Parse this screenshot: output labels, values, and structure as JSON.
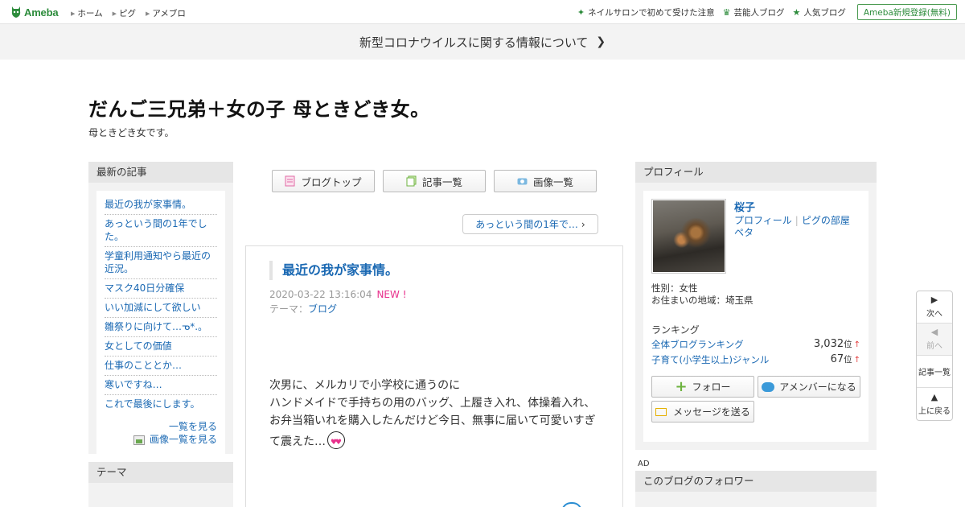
{
  "global_header": {
    "logo_text": "Ameba",
    "nav": [
      "ホーム",
      "ピグ",
      "アメブロ"
    ],
    "right_links": [
      {
        "icon": "sparkle-icon",
        "label": "ネイルサロンで初めて受けた注意"
      },
      {
        "icon": "crown-icon",
        "label": "芸能人ブログ"
      },
      {
        "icon": "star-icon",
        "label": "人気ブログ"
      }
    ],
    "register_label": "Ameba新規登録(無料)"
  },
  "banner": {
    "text": "新型コロナウイルスに関する情報について"
  },
  "blog": {
    "title": "だんご三兄弟＋女の子 母ときどき女。",
    "description": "母ときどき女です。"
  },
  "recent": {
    "heading": "最新の記事",
    "items": [
      "最近の我が家事情。",
      "あっという間の1年でした。",
      "学童利用通知やら最近の近況。",
      "マスク40日分確保",
      "いい加減にして欲しい",
      "雛祭りに向けて…ᓀ*.。",
      "女としての価値",
      "仕事のこととか…",
      "寒いですね…",
      "これで最後にします。"
    ],
    "see_list": "一覧を見る",
    "see_images": "画像一覧を見る"
  },
  "theme_box": {
    "heading": "テーマ"
  },
  "tabs": [
    "ブログトップ",
    "記事一覧",
    "画像一覧"
  ],
  "prev_article": "あっという間の1年で…",
  "article": {
    "title": "最近の我が家事情。",
    "datetime": "2020-03-22 13:16:04",
    "new_badge": "NEW !",
    "theme_label": "テーマ：",
    "theme": "ブログ",
    "body": [
      "次男に、メルカリで小学校に通うのに",
      "ハンドメイドで手持ちの用のバッグ、上履き入れ、体操着入れ、",
      "お弁当箱いれを購入したんだけど今日、無事に届いて可愛いすぎ",
      "て震えた…"
    ]
  },
  "profile": {
    "heading": "プロフィール",
    "name": "桜子",
    "link_profile": "プロフィール",
    "link_pig": "ピグの部屋",
    "link_peta": "ペタ",
    "gender": "性別：女性",
    "area": "お住まいの地域：埼玉県",
    "ranking_heading": "ランキング",
    "rankings": [
      {
        "label": "全体ブログランキング",
        "value": "3,032",
        "unit": "位",
        "trend": "↑"
      },
      {
        "label": "子育て(小学生以上)ジャンル",
        "value": "67",
        "unit": "位",
        "trend": "↑"
      }
    ],
    "follow_label": "フォロー",
    "amember_label": "アメンバーになる",
    "message_label": "メッセージを送る"
  },
  "ad_label": "AD",
  "followers": {
    "heading": "このブログのフォロワー"
  },
  "float_nav": {
    "next": "次へ",
    "prev": "前へ",
    "list": "記事一覧",
    "top": "上に戻る"
  },
  "colors": {
    "link": "#1b69b3",
    "brand_green": "#2d8c3c",
    "new_badge": "#e8308c",
    "panel_bg": "#f2f2f2"
  }
}
